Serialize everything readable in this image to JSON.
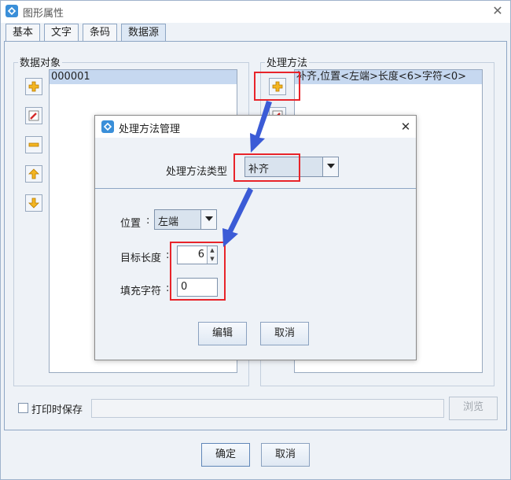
{
  "window": {
    "title": "图形属性",
    "close_glyph": "✕"
  },
  "tabs": [
    {
      "label": "基本"
    },
    {
      "label": "文字"
    },
    {
      "label": "条码"
    },
    {
      "label": "数据源",
      "active": true
    }
  ],
  "data_object": {
    "legend": "数据对象",
    "items": [
      "000001"
    ]
  },
  "processing": {
    "legend": "处理方法",
    "items": [
      "补齐,位置<左端>长度<6>字符<0>"
    ]
  },
  "print_save": {
    "label": "打印时保存",
    "checked": false,
    "path_value": "",
    "browse_label": "浏览"
  },
  "footer": {
    "ok_label": "确定",
    "cancel_label": "取消"
  },
  "dialog": {
    "title": "处理方法管理",
    "close_glyph": "✕",
    "type_label": "处理方法类型",
    "type_value": "补齐",
    "position_label": "位置",
    "position_value": "左端",
    "length_label": "目标长度",
    "length_value": "6",
    "fill_label": "填充字符",
    "fill_value": "0",
    "edit_label": "编辑",
    "cancel_label": "取消"
  },
  "colors": {
    "annotation_red": "#e8242a",
    "annotation_arrow": "#3b5bd6",
    "selection": "#c6d8f0",
    "border_accent": "#8ea6c4"
  }
}
